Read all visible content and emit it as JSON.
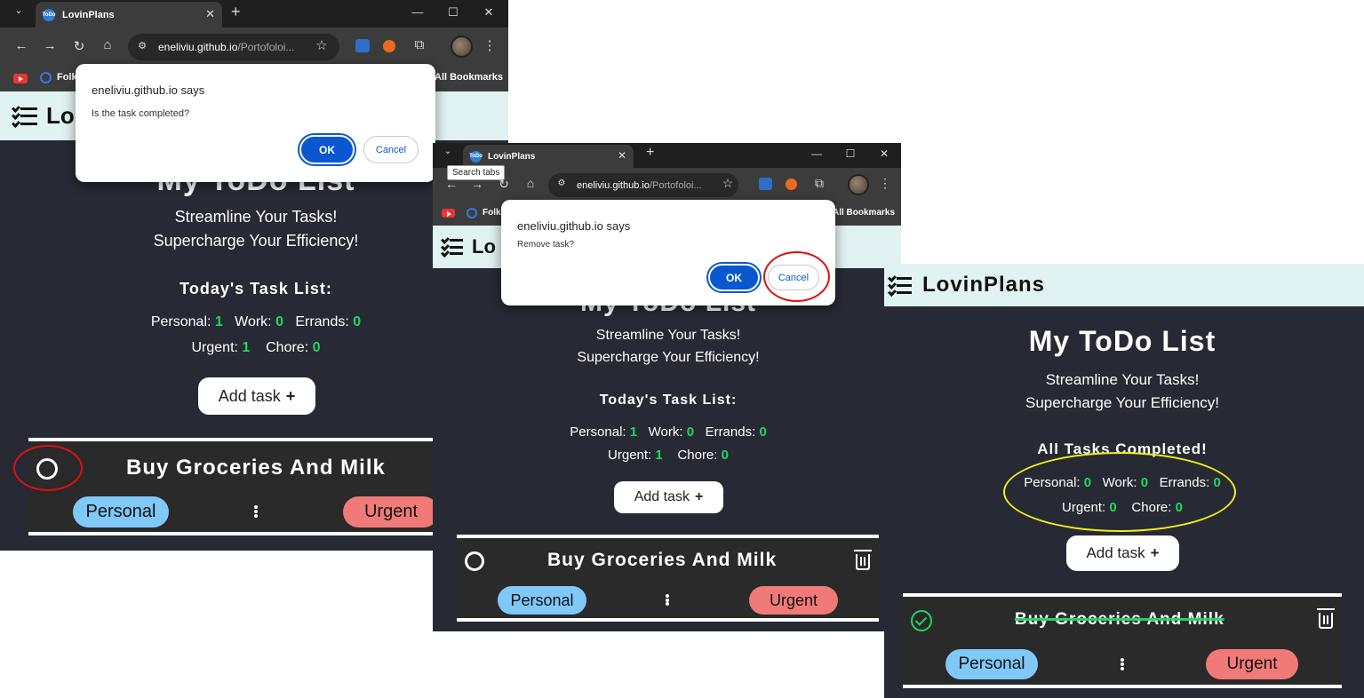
{
  "browser": {
    "tab_title": "LovinPlans",
    "favicon_text": "ToDo",
    "url_domain": "eneliviu.github.io",
    "url_path": "/Portofoloi...",
    "bookmark_folk": "Folk",
    "bookmark_all": "All Bookmarks",
    "tooltip_search_tabs": "Search tabs",
    "icons": [
      "chevron-down-icon",
      "close-icon",
      "plus-icon",
      "minimize-icon",
      "maximize-icon",
      "back-icon",
      "forward-icon",
      "reload-icon",
      "home-icon",
      "site-settings-icon",
      "star-icon",
      "extension-icon",
      "puzzle-icon",
      "menu-dots-icon"
    ]
  },
  "app": {
    "brand": "LovinPlans",
    "brand_cut": "Lo",
    "heading": "My ToDo List",
    "heading_cut": "My ToDo List",
    "subtitle_line1": "Streamline Your Tasks!",
    "subtitle_line2": "Supercharge Your Efficiency!",
    "list_title": "Today's Task List:",
    "all_done_title": "All Tasks Completed!",
    "labels": {
      "personal": "Personal:",
      "work": "Work:",
      "errands": "Errands:",
      "urgent": "Urgent:",
      "chore": "Chore:"
    },
    "add_task": "Add task",
    "add_plus": "+",
    "colors": {
      "bg": "#272a34",
      "header": "#e0f2f1",
      "count": "#1ed760",
      "personal": "#7fc8f8",
      "urgent": "#f07a77",
      "accent_blue": "#0b57d0"
    }
  },
  "screens": [
    {
      "counts": {
        "personal": "1",
        "work": "0",
        "errands": "0",
        "urgent": "1",
        "chore": "0"
      },
      "task": {
        "title": "Buy Groceries And Milk",
        "tag1": "Personal",
        "tag2": "Urgent",
        "completed": false
      },
      "dialog": {
        "origin": "eneliviu.github.io says",
        "message": "Is the task completed?",
        "ok": "OK",
        "cancel": "Cancel"
      }
    },
    {
      "counts": {
        "personal": "1",
        "work": "0",
        "errands": "0",
        "urgent": "1",
        "chore": "0"
      },
      "task": {
        "title": "Buy Groceries And Milk",
        "tag1": "Personal",
        "tag2": "Urgent",
        "completed": false
      },
      "dialog": {
        "origin": "eneliviu.github.io says",
        "message": "Remove task?",
        "ok": "OK",
        "cancel": "Cancel"
      }
    },
    {
      "counts": {
        "personal": "0",
        "work": "0",
        "errands": "0",
        "urgent": "0",
        "chore": "0"
      },
      "task": {
        "title": "Buy Groceries And Milk",
        "tag1": "Personal",
        "tag2": "Urgent",
        "completed": true
      }
    }
  ]
}
